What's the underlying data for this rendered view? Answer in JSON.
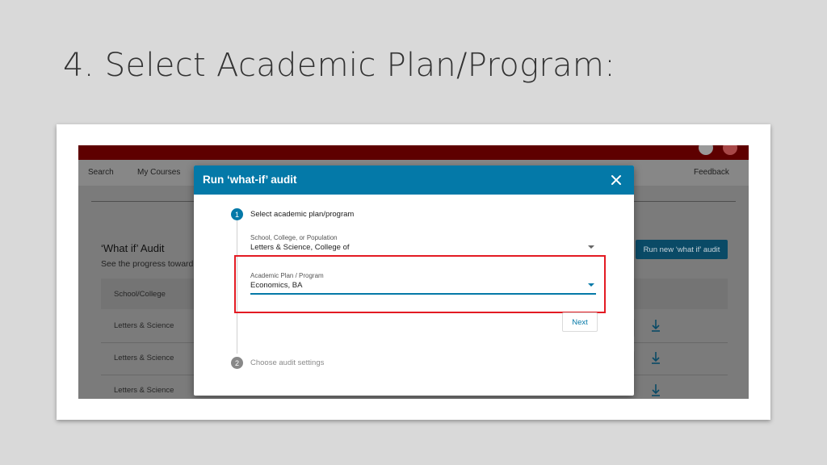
{
  "slide": {
    "title": "4.  Select Academic Plan/Program:"
  },
  "nav": {
    "search": "Search",
    "my_courses": "My Courses",
    "feedback": "Feedback"
  },
  "page": {
    "heading": "‘What if’ Audit",
    "subtitle": "See the progress toward",
    "run_new_button": "Run new ‘what if’ audit",
    "table": {
      "header_school": "School/College",
      "rows": [
        {
          "school": "Letters & Science"
        },
        {
          "school": "Letters & Science"
        },
        {
          "school": "Letters & Science"
        }
      ]
    }
  },
  "modal": {
    "title": "Run ‘what-if’ audit",
    "step1": {
      "number": "1",
      "label": "Select academic plan/program"
    },
    "step2": {
      "number": "2",
      "label": "Choose audit settings"
    },
    "school_field": {
      "label": "School, College, or Population",
      "value": "Letters & Science, College of"
    },
    "plan_field": {
      "label": "Academic Plan / Program",
      "value": "Economics, BA"
    },
    "next_button": "Next"
  },
  "colors": {
    "accent": "#0479a8",
    "highlight": "#e31b23",
    "top_bar": "#8b0000"
  },
  "icons": [
    "close-icon",
    "dropdown-arrow-icon",
    "download-icon",
    "help-icon",
    "avatar"
  ]
}
